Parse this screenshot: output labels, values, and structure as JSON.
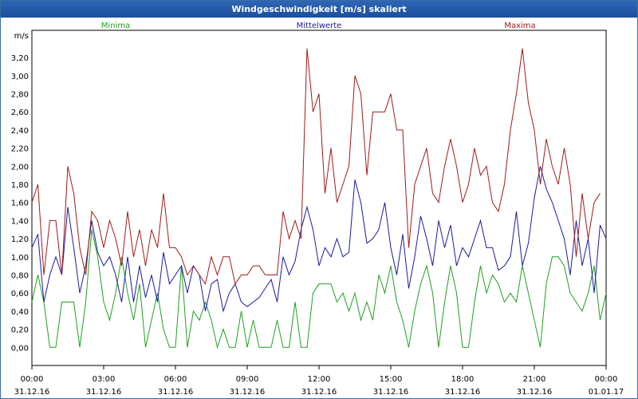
{
  "title": "Windgeschwindigkeit [m/s] skaliert",
  "chart_data": {
    "type": "line",
    "ylabel": "m/s",
    "ylim": [
      -0.2,
      3.5
    ],
    "yticks": [
      "0,00",
      "0,20",
      "0,40",
      "0,60",
      "0,80",
      "1,00",
      "1,20",
      "1,40",
      "1,60",
      "1,80",
      "2,00",
      "2,20",
      "2,40",
      "2,60",
      "2,80",
      "3,00",
      "3,20"
    ],
    "xticks": [
      {
        "time": "00:00",
        "date": "31.12.16"
      },
      {
        "time": "03:00",
        "date": "31.12.16"
      },
      {
        "time": "06:00",
        "date": "31.12.16"
      },
      {
        "time": "09:00",
        "date": "31.12.16"
      },
      {
        "time": "12:00",
        "date": "31.12.16"
      },
      {
        "time": "15:00",
        "date": "31.12.16"
      },
      {
        "time": "18:00",
        "date": "31.12.16"
      },
      {
        "time": "21:00",
        "date": "31.12.16"
      },
      {
        "time": "00:00",
        "date": "01.01.17"
      }
    ],
    "grid": true,
    "x_hours": [
      0,
      0.25,
      0.5,
      0.75,
      1,
      1.25,
      1.5,
      1.75,
      2,
      2.25,
      2.5,
      2.75,
      3,
      3.25,
      3.5,
      3.75,
      4,
      4.25,
      4.5,
      4.75,
      5,
      5.25,
      5.5,
      5.75,
      6,
      6.25,
      6.5,
      6.75,
      7,
      7.25,
      7.5,
      7.75,
      8,
      8.25,
      8.5,
      8.75,
      9,
      9.25,
      9.5,
      9.75,
      10,
      10.25,
      10.5,
      10.75,
      11,
      11.25,
      11.5,
      11.75,
      12,
      12.25,
      12.5,
      12.75,
      13,
      13.25,
      13.5,
      13.75,
      14,
      14.25,
      14.5,
      14.75,
      15,
      15.25,
      15.5,
      15.75,
      16,
      16.25,
      16.5,
      16.75,
      17,
      17.25,
      17.5,
      17.75,
      18,
      18.25,
      18.5,
      18.75,
      19,
      19.25,
      19.5,
      19.75,
      20,
      20.25,
      20.5,
      20.75,
      21,
      21.25,
      21.5,
      21.75,
      22,
      22.25,
      22.5,
      22.75,
      23,
      23.25,
      23.5,
      23.75,
      24
    ],
    "series": [
      {
        "name": "Minima",
        "color": "#1fa01f",
        "values": [
          0.5,
          0.8,
          0.5,
          0.0,
          0.0,
          0.5,
          0.5,
          0.5,
          0.0,
          0.5,
          1.3,
          1.0,
          0.5,
          0.3,
          0.6,
          1.0,
          0.6,
          0.3,
          0.7,
          0.0,
          0.3,
          0.6,
          0.2,
          0.0,
          0.0,
          0.9,
          0.0,
          0.4,
          0.3,
          0.5,
          0.3,
          0.0,
          0.2,
          0.0,
          0.0,
          0.4,
          0.0,
          0.3,
          0.0,
          0.0,
          0.0,
          0.3,
          0.0,
          0.0,
          0.5,
          0.0,
          0.0,
          0.6,
          0.7,
          0.7,
          0.7,
          0.5,
          0.6,
          0.4,
          0.6,
          0.3,
          0.5,
          0.3,
          0.8,
          0.6,
          0.9,
          0.5,
          0.3,
          0.0,
          0.4,
          0.7,
          0.9,
          0.6,
          0.0,
          0.5,
          0.9,
          0.6,
          0.0,
          0.0,
          0.5,
          0.9,
          0.6,
          0.8,
          0.7,
          0.5,
          0.6,
          0.5,
          0.9,
          0.6,
          0.3,
          0.0,
          0.7,
          1.0,
          1.0,
          0.9,
          0.6,
          0.5,
          0.4,
          0.6,
          0.9,
          0.3,
          0.6
        ]
      },
      {
        "name": "Mittelwerte",
        "color": "#1a1aa0",
        "values": [
          1.1,
          1.25,
          0.5,
          0.8,
          1.0,
          0.8,
          1.55,
          1.1,
          0.6,
          0.9,
          1.4,
          1.05,
          0.9,
          1.0,
          0.8,
          0.5,
          1.0,
          0.5,
          0.9,
          0.55,
          0.8,
          0.5,
          1.05,
          0.7,
          0.8,
          0.9,
          0.6,
          0.9,
          0.8,
          0.4,
          0.7,
          0.75,
          0.4,
          0.6,
          0.7,
          0.5,
          0.45,
          0.5,
          0.55,
          0.65,
          0.75,
          0.5,
          1.0,
          0.8,
          0.95,
          1.3,
          1.55,
          1.3,
          0.9,
          1.1,
          1.0,
          1.2,
          1.0,
          1.05,
          1.85,
          1.6,
          1.15,
          1.2,
          1.3,
          1.6,
          1.1,
          0.8,
          1.25,
          0.65,
          1.0,
          1.45,
          1.2,
          0.9,
          1.4,
          1.1,
          1.35,
          0.9,
          1.1,
          1.0,
          1.2,
          1.4,
          1.1,
          1.1,
          0.85,
          0.9,
          1.0,
          1.5,
          0.9,
          1.15,
          1.65,
          2.0,
          1.75,
          1.6,
          1.4,
          1.2,
          0.8,
          1.4,
          0.9,
          1.2,
          0.6,
          1.35,
          1.2
        ]
      },
      {
        "name": "Maxima",
        "color": "#a01a1a",
        "values": [
          1.6,
          1.8,
          0.8,
          1.4,
          1.4,
          0.8,
          2.0,
          1.7,
          1.1,
          0.8,
          1.5,
          1.4,
          1.1,
          1.4,
          1.2,
          0.9,
          1.5,
          1.0,
          1.3,
          0.9,
          1.3,
          1.1,
          1.7,
          1.1,
          1.1,
          1.0,
          0.8,
          0.9,
          0.8,
          0.7,
          1.0,
          0.8,
          1.0,
          1.0,
          0.7,
          0.8,
          0.8,
          0.9,
          0.9,
          0.8,
          0.8,
          0.8,
          1.5,
          1.2,
          1.4,
          1.2,
          3.3,
          2.6,
          2.8,
          1.7,
          2.2,
          1.6,
          1.8,
          2.0,
          3.0,
          2.8,
          1.9,
          2.6,
          2.6,
          2.6,
          2.8,
          2.4,
          2.4,
          1.1,
          1.8,
          2.0,
          2.2,
          1.7,
          1.6,
          2.0,
          2.3,
          2.0,
          1.6,
          1.8,
          2.2,
          1.9,
          2.0,
          1.6,
          1.5,
          1.8,
          2.4,
          2.8,
          3.3,
          2.7,
          2.4,
          1.8,
          2.3,
          2.0,
          1.8,
          2.2,
          1.8,
          1.0,
          1.7,
          1.2,
          1.6,
          1.7
        ]
      }
    ]
  }
}
